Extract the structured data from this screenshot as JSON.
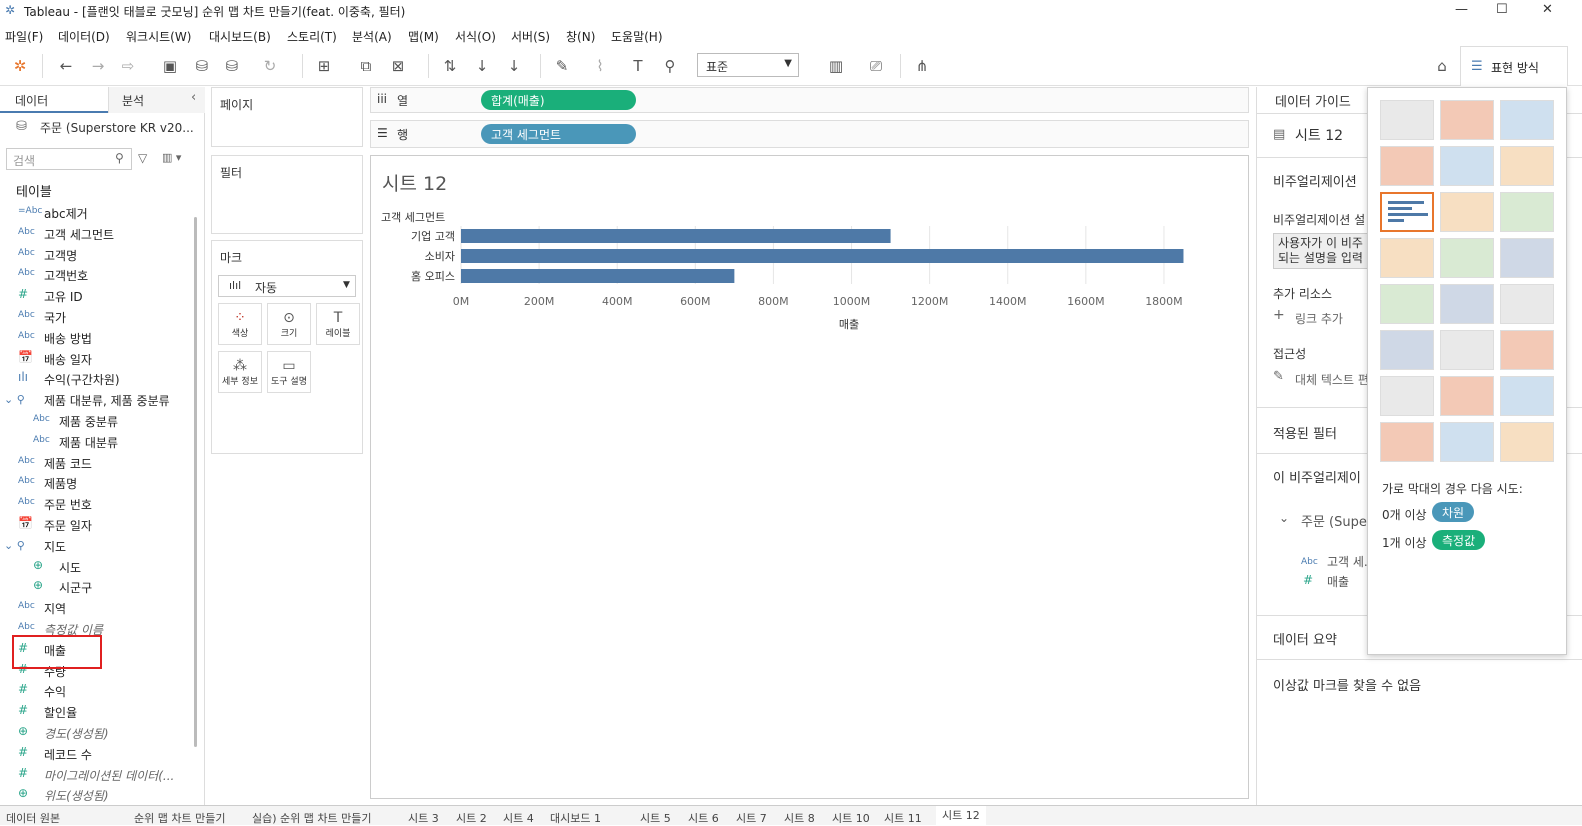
{
  "window": {
    "title": "Tableau - [플랜잇 태블로 굿모닝] 순위 맵 차트 만들기(feat. 이중축, 필터)",
    "minimize": "—",
    "maximize": "☐",
    "close": "✕"
  },
  "menu": [
    "파일(F)",
    "데이터(D)",
    "워크시트(W)",
    "대시보드(B)",
    "스토리(T)",
    "분석(A)",
    "맵(M)",
    "서식(O)",
    "서버(S)",
    "창(N)",
    "도움말(H)"
  ],
  "toolbar": {
    "fit_select": "표준",
    "showme_label": "표현 방식"
  },
  "left": {
    "tab_data": "데이터",
    "tab_analysis": "분석",
    "datasource": "주문 (Superstore KR v20...",
    "search_placeholder": "검색",
    "tables_label": "테이블",
    "fields": [
      {
        "icon": "=Abc",
        "name": "abc제거"
      },
      {
        "icon": "Abc",
        "name": "고객 세그먼트"
      },
      {
        "icon": "Abc",
        "name": "고객명"
      },
      {
        "icon": "Abc",
        "name": "고객번호"
      },
      {
        "icon": "#",
        "name": "고유 ID"
      },
      {
        "icon": "Abc",
        "name": "국가"
      },
      {
        "icon": "Abc",
        "name": "배송 방법"
      },
      {
        "icon": "📅",
        "name": "배송 일자"
      },
      {
        "icon": "ılı",
        "name": "수익(구간차원)"
      },
      {
        "icon": "⌄ ⚲",
        "name": "제품 대분류, 제품 중분류"
      },
      {
        "icon": "Abc",
        "name": "제품 중분류",
        "sub": true
      },
      {
        "icon": "Abc",
        "name": "제품 대분류",
        "sub": true
      },
      {
        "icon": "Abc",
        "name": "제품 코드"
      },
      {
        "icon": "Abc",
        "name": "제품명"
      },
      {
        "icon": "Abc",
        "name": "주문 번호"
      },
      {
        "icon": "📅",
        "name": "주문 일자"
      },
      {
        "icon": "⌄ ⚲",
        "name": "지도"
      },
      {
        "icon": "⊕",
        "name": "시도",
        "sub": true
      },
      {
        "icon": "⊕",
        "name": "시군구",
        "sub": true
      },
      {
        "icon": "Abc",
        "name": "지역"
      },
      {
        "icon": "Abc",
        "name": "측정값 이름",
        "italic": true
      },
      {
        "icon": "#",
        "name": "매출"
      },
      {
        "icon": "#",
        "name": "수량"
      },
      {
        "icon": "#",
        "name": "수익"
      },
      {
        "icon": "#",
        "name": "할인율"
      },
      {
        "icon": "⊕",
        "name": "경도(생성됨)",
        "italic": true
      },
      {
        "icon": "#",
        "name": "레코드 수"
      },
      {
        "icon": "#",
        "name": "마이그레이션된 데이터(...",
        "italic": true
      },
      {
        "icon": "⊕",
        "name": "위도(생성됨)",
        "italic": true
      }
    ]
  },
  "shelves": {
    "pages": "페이지",
    "filters": "필터",
    "marks": "마크",
    "marks_type": "자동",
    "cards": [
      "색상",
      "크기",
      "레이블",
      "세부 정보",
      "도구 설명"
    ],
    "columns_label": "열",
    "rows_label": "행",
    "columns_pill": "합계(매출)",
    "rows_pill": "고객 세그먼트"
  },
  "view": {
    "sheet_title": "시트 12"
  },
  "chart_data": {
    "type": "bar",
    "title": "시트 12",
    "categories": [
      "기업 고객",
      "소비자",
      "홈 오피스"
    ],
    "values": [
      1100,
      1850,
      700
    ],
    "header_label": "고객 세그먼트",
    "xlabel": "매출",
    "xlim": [
      0,
      1900
    ],
    "ticks": [
      "0M",
      "200M",
      "400M",
      "600M",
      "800M",
      "1000M",
      "1200M",
      "1400M",
      "1600M",
      "1800M"
    ],
    "tick_values": [
      0,
      200,
      400,
      600,
      800,
      1000,
      1200,
      1400,
      1600,
      1800
    ],
    "color": "#4e79a7",
    "grid": true
  },
  "right": {
    "data_guide": "데이터 가이드",
    "sheet": "시트 12",
    "viz_desc": "비주얼리제이션",
    "viz_desc_sub": "비주얼리제이션 설",
    "desc_box1": "사용자가 이 비주",
    "desc_box2": "되는 설명을 입력",
    "extra_resources": "추가 리소스",
    "add_link": "링크 추가",
    "accessibility": "접근성",
    "alt_text": "대체 텍스트 편",
    "applied_filters": "적용된 필터",
    "this_viz": "이 비주얼리제이",
    "datasource": "주문 (Supe",
    "field1": "고객 세...",
    "field2": "매출",
    "data_summary": "데이터 요약",
    "outliers": "이상값 마크를 찾을 수 없음"
  },
  "showme": {
    "hint": "가로 막대의 경우 다음 시도:",
    "dim_count": "0개 이상",
    "dim_label": "차원",
    "meas_count": "1개 이상",
    "meas_label": "측정값"
  },
  "bottom_tabs": [
    "데이터 원본",
    "순위 맵 차트 만들기",
    "실습) 순위 맵 차트 만들기",
    "시트 3",
    "시트 2",
    "시트 4",
    "대시보드 1",
    "시트 5",
    "시트 6",
    "시트 7",
    "시트 8",
    "시트 10",
    "시트 11",
    "시트 12"
  ],
  "colors": {
    "pill_green": "#1aaf7a",
    "pill_blue": "#4a97b9",
    "bar": "#4e79a7",
    "highlight": "#e02020"
  }
}
